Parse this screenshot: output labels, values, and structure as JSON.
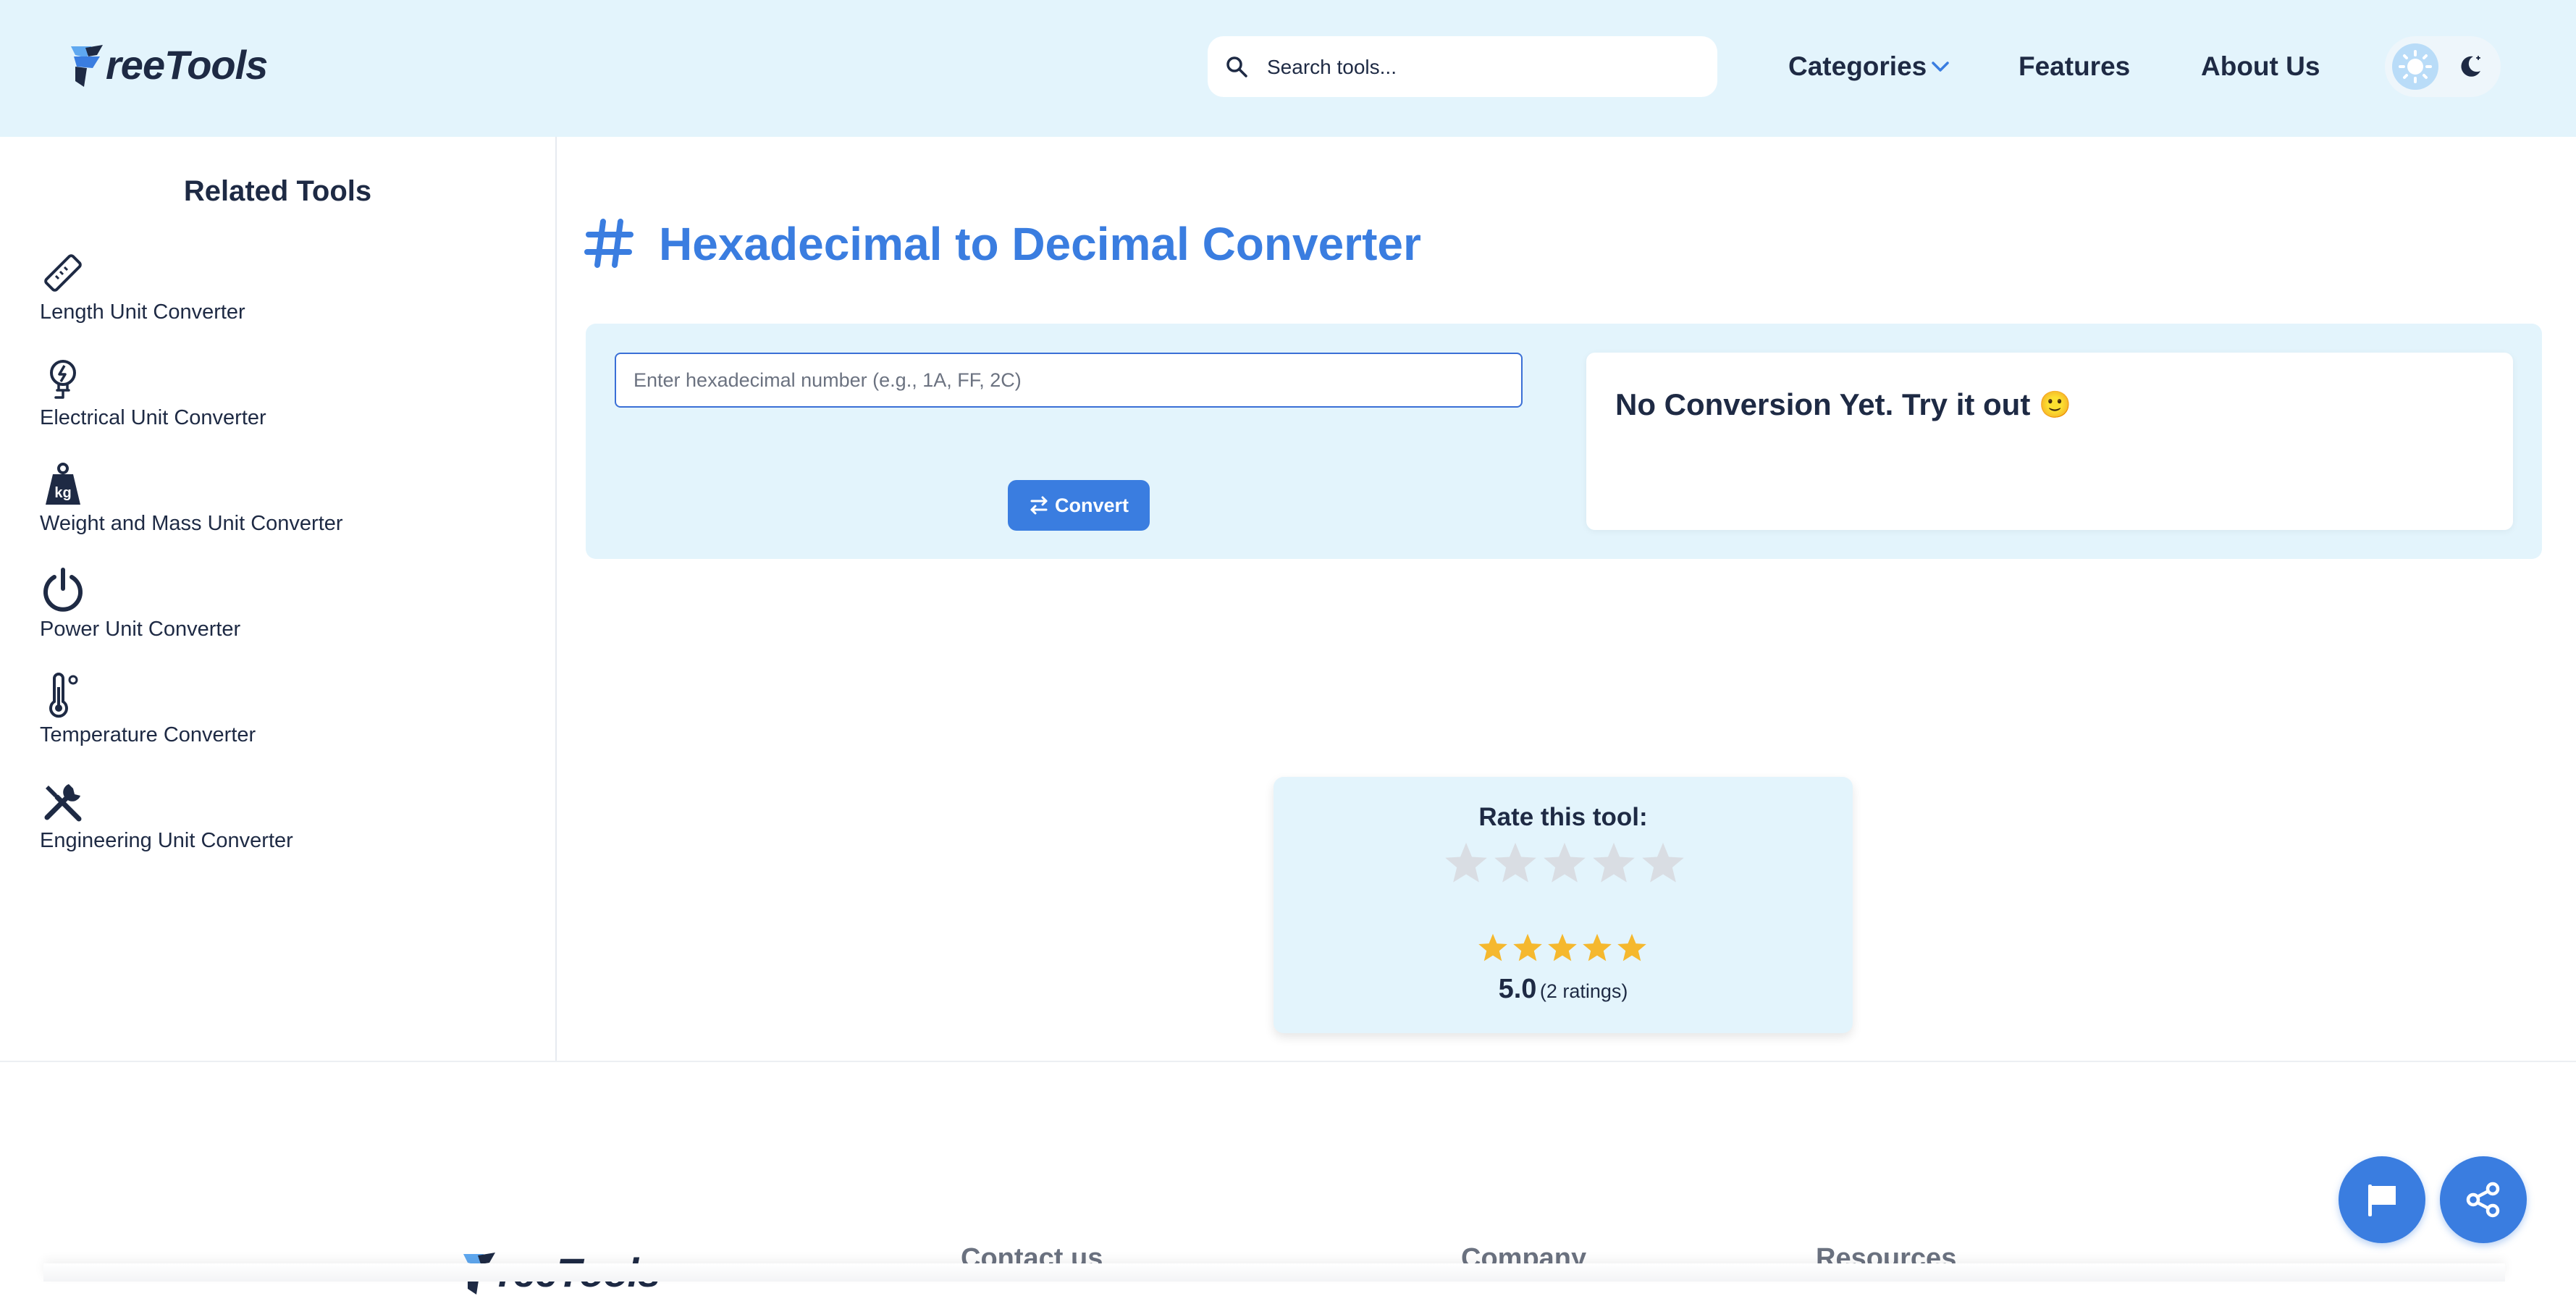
{
  "header": {
    "logo_text": "reeTools",
    "search_placeholder": "Search tools...",
    "nav": {
      "categories": "Categories",
      "features": "Features",
      "about": "About Us"
    },
    "theme": {
      "light_icon": "sun-icon",
      "dark_icon": "moon-icon"
    }
  },
  "sidebar": {
    "title": "Related Tools",
    "items": [
      {
        "label": "Length Unit Converter",
        "icon": "ruler-icon"
      },
      {
        "label": "Electrical Unit Converter",
        "icon": "electrical-plug-icon"
      },
      {
        "label": "Weight and Mass Unit Converter",
        "icon": "weight-kg-icon"
      },
      {
        "label": "Power Unit Converter",
        "icon": "power-icon"
      },
      {
        "label": "Temperature Converter",
        "icon": "thermometer-icon"
      },
      {
        "label": "Engineering Unit Converter",
        "icon": "tools-icon"
      }
    ]
  },
  "main": {
    "title": "Hexadecimal to Decimal Converter",
    "title_icon": "hash-icon",
    "input_placeholder": "Enter hexadecimal number (e.g., 1A, FF, 2C)",
    "convert_label": "Convert",
    "result_text": "No Conversion Yet. Try it out",
    "result_emoji": "🙂"
  },
  "rating": {
    "title": "Rate this tool:",
    "user_rating": 0,
    "average": "5.0",
    "count_text": "(2 ratings)",
    "average_stars": 5
  },
  "footer": {
    "logo_text": "reeTools",
    "headings": [
      "Contact us",
      "Company",
      "Resources"
    ]
  },
  "colors": {
    "accent": "#3a7de0",
    "header_bg": "#e3f4fc",
    "star_filled": "#f5b82e",
    "star_empty": "#d9dde3",
    "text": "#1e2a44"
  }
}
